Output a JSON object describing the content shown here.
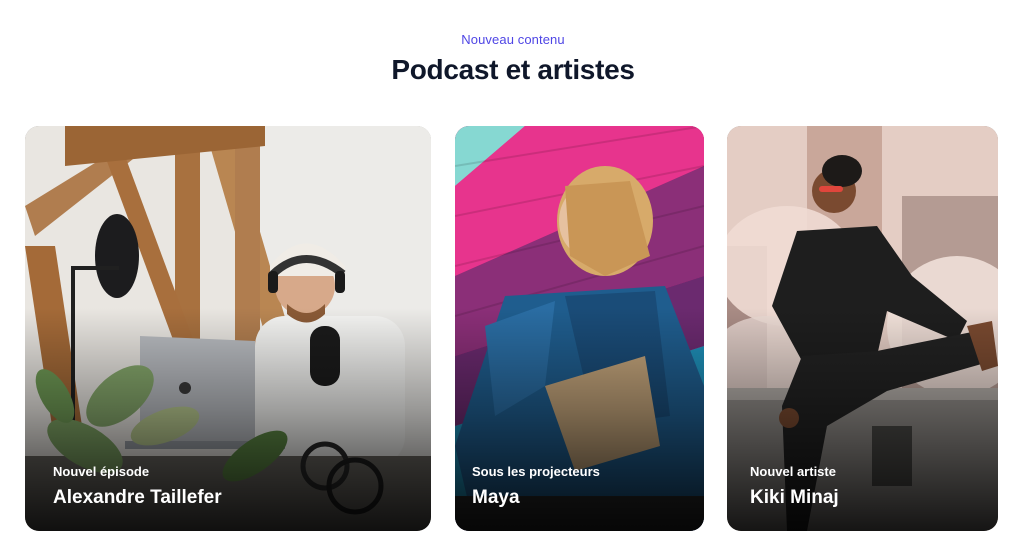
{
  "section": {
    "eyebrow": "Nouveau contenu",
    "title": "Podcast et artistes"
  },
  "cards": [
    {
      "kicker": "Nouvel épisode",
      "name": "Alexandre Taillefer",
      "image_subject": "man-with-headphones-at-microphone"
    },
    {
      "kicker": "Sous les projecteurs",
      "name": "Maya",
      "image_subject": "woman-against-pink-wall"
    },
    {
      "kicker": "Nouvel artiste",
      "name": "Kiki Minaj",
      "image_subject": "woman-on-rooftop-with-steam"
    }
  ],
  "colors": {
    "eyebrow": "#4f46e5",
    "title": "#0f172a",
    "card_text": "#ffffff"
  }
}
